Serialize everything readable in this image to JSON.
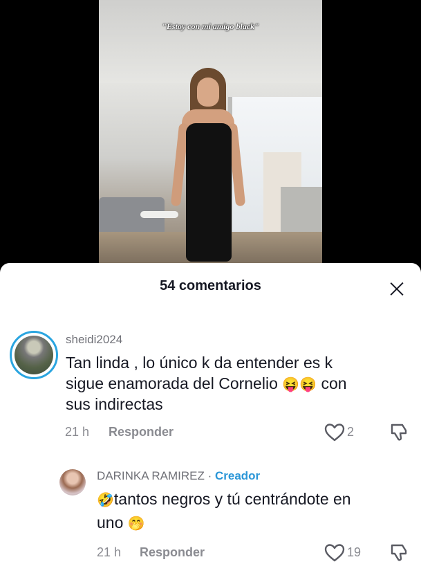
{
  "video": {
    "caption": "\"Estoy con mi amigo black\""
  },
  "comments_sheet": {
    "title": "54 comentarios",
    "close_icon": "close-icon"
  },
  "comments": [
    {
      "username": "sheidi2024",
      "text_1": "Tan linda , lo único k da entender es k",
      "text_2": "sigue enamorada del Cornelio",
      "emoji_1": "😝😝",
      "text_2b": " con",
      "text_3": "sus indirectas",
      "time": "21 h",
      "reply_label": "Responder",
      "likes": "2"
    },
    {
      "username": "DARINKA RAMIREZ",
      "separator": " · ",
      "badge": "Creador",
      "emoji_1": "🤣",
      "text_1": "tantos negros y tú centrándote en",
      "text_2": "uno",
      "emoji_2": "🤭",
      "time": "21 h",
      "reply_label": "Responder",
      "likes": "19"
    }
  ],
  "colors": {
    "creator_badge": "#2c97d8",
    "story_ring": "#2aa5e0"
  },
  "icons": [
    "heart-outline-icon",
    "dislike-icon",
    "close-icon"
  ]
}
